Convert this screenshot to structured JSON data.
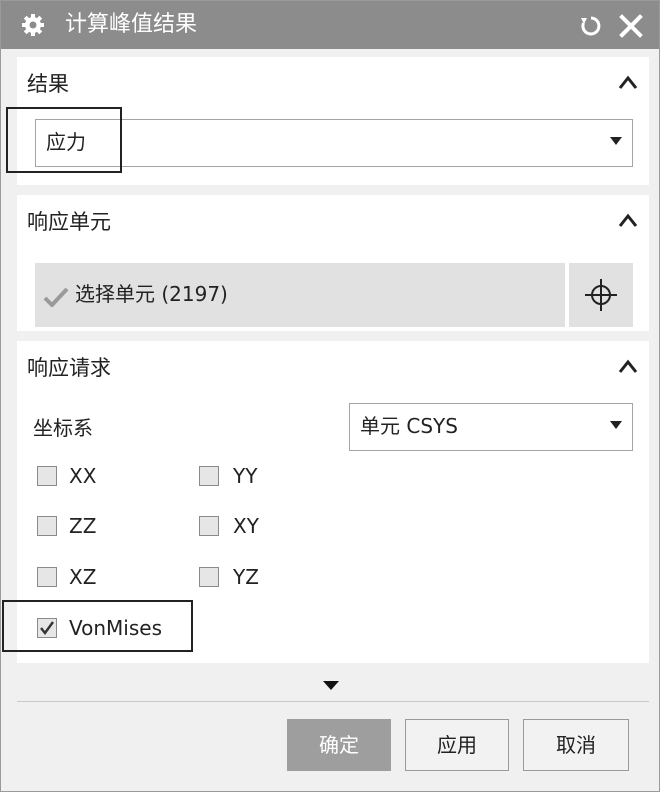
{
  "dialog": {
    "title": "计算峰值结果",
    "icons": {
      "title": "gear-icon",
      "reset": "reset-icon",
      "close": "close-icon"
    }
  },
  "results_section": {
    "title": "结果",
    "selected_result": "应力"
  },
  "response_elements_section": {
    "title": "响应单元",
    "select_elements_label": "选择单元 (2197)"
  },
  "response_request_section": {
    "title": "响应请求",
    "coordinate_system_label": "坐标系",
    "coordinate_system_value": "单元 CSYS",
    "components": [
      {
        "label": "XX",
        "checked": false
      },
      {
        "label": "YY",
        "checked": false
      },
      {
        "label": "ZZ",
        "checked": false
      },
      {
        "label": "XY",
        "checked": false
      },
      {
        "label": "XZ",
        "checked": false
      },
      {
        "label": "YZ",
        "checked": false
      },
      {
        "label": "VonMises",
        "checked": true
      }
    ]
  },
  "buttons": {
    "ok": "确定",
    "apply": "应用",
    "cancel": "取消"
  }
}
